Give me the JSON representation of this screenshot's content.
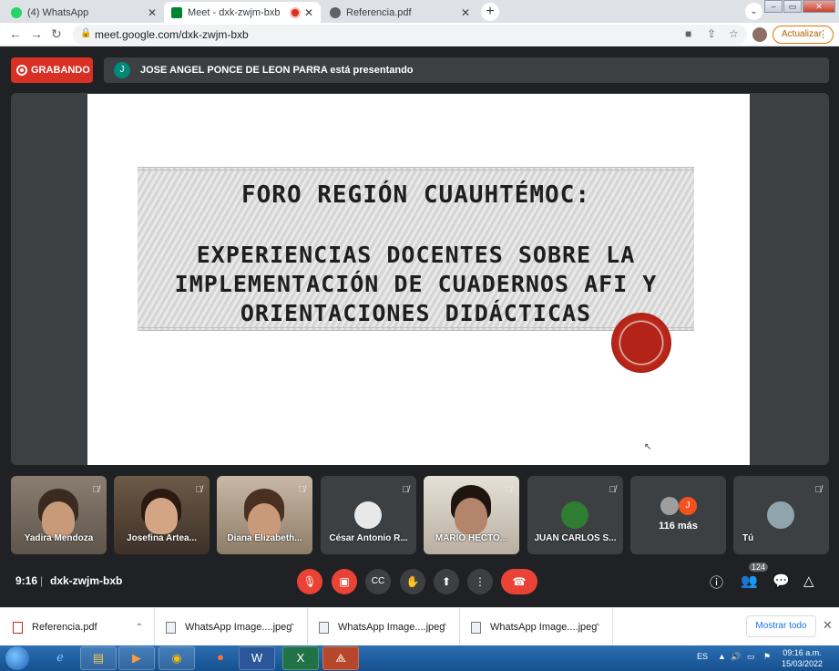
{
  "browser": {
    "tabs": [
      {
        "title": "(4) WhatsApp",
        "favicon_color": "#25d366"
      },
      {
        "title": "Meet - dxk-zwjm-bxb",
        "favicon_color": "#00832d",
        "recording": true
      },
      {
        "title": "Referencia.pdf",
        "favicon_color": "#5f6368"
      }
    ],
    "new_tab": "+",
    "url": "meet.google.com/dxk-zwjm-bxb",
    "update_label": "Actualizar"
  },
  "meet": {
    "recording_label": "GRABANDO",
    "presenter_initial": "J",
    "presenter_text": "JOSE ANGEL PONCE DE LEON PARRA está presentando",
    "slide": {
      "line1": "FORO REGIÓN CUAUHTÉMOC:",
      "line2": "EXPERIENCIAS DOCENTES SOBRE LA",
      "line3": "IMPLEMENTACIÓN DE CUADERNOS AFI Y",
      "line4": "ORIENTACIONES DIDÁCTICAS"
    },
    "participants": [
      {
        "name": "Yadira Mendoza"
      },
      {
        "name": "Josefina Artea..."
      },
      {
        "name": "Diana Elizabeth..."
      },
      {
        "name": "César Antonio R..."
      },
      {
        "name": "MARIO HECTO..."
      },
      {
        "name": "JUAN CARLOS S..."
      },
      {
        "name": "116 más",
        "more_initial": "J"
      },
      {
        "name": "Tú"
      }
    ],
    "time": "9:16",
    "separator": "|",
    "meeting_code": "dxk-zwjm-bxb",
    "participant_count": "124"
  },
  "downloads": {
    "items": [
      {
        "name": "Referencia.pdf"
      },
      {
        "name": "WhatsApp Image....jpeg"
      },
      {
        "name": "WhatsApp Image....jpeg"
      },
      {
        "name": "WhatsApp Image....jpeg"
      }
    ],
    "show_all": "Mostrar todo"
  },
  "taskbar": {
    "language": "ES",
    "time": "09:16 a.m.",
    "date": "15/03/2022"
  },
  "colors": {
    "meet_bg": "#202124",
    "tile_bg": "#3c4043",
    "danger": "#ea4335",
    "accent": "#1a73e8"
  }
}
